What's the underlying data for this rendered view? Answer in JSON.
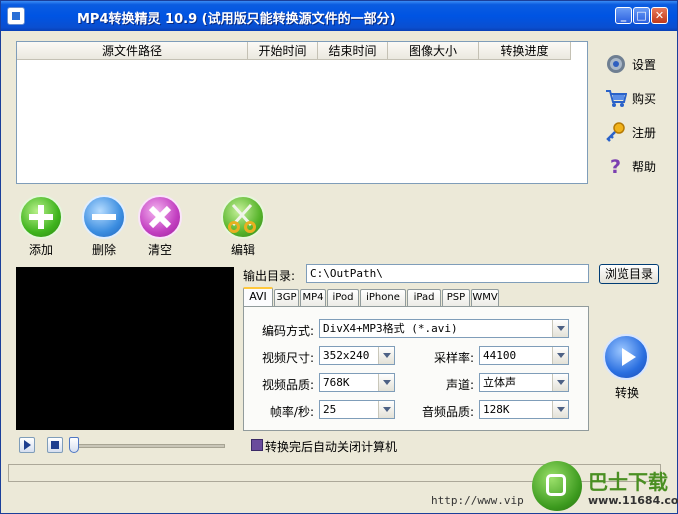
{
  "window": {
    "title": "MP4转换精灵 10.9 (试用版只能转换源文件的一部分)",
    "controls": {
      "minimize": "_",
      "maximize": "□",
      "close": "✕"
    }
  },
  "file_list": {
    "columns": [
      "源文件路径",
      "开始时间",
      "结束时间",
      "图像大小",
      "转换进度"
    ],
    "rows": []
  },
  "sidebar": {
    "items": [
      {
        "label": "设置",
        "icon": "gear-icon"
      },
      {
        "label": "购买",
        "icon": "cart-icon"
      },
      {
        "label": "注册",
        "icon": "key-icon"
      },
      {
        "label": "帮助",
        "icon": "help-icon"
      }
    ]
  },
  "toolbar": {
    "add_label": "添加",
    "delete_label": "删除",
    "clear_label": "清空",
    "edit_label": "编辑"
  },
  "output": {
    "label": "输出目录:",
    "path": "C:\\OutPath\\",
    "browse_label": "浏览目录"
  },
  "format_tabs": [
    "AVI",
    "3GP",
    "MP4",
    "iPod",
    "iPhone",
    "iPad",
    "PSP",
    "WMV"
  ],
  "active_tab": "AVI",
  "settings": {
    "codec": {
      "label": "编码方式:",
      "value": "DivX4+MP3格式 (*.avi)"
    },
    "video_size": {
      "label": "视频尺寸:",
      "value": "352x240"
    },
    "video_quality": {
      "label": "视频品质:",
      "value": "768K"
    },
    "frame_rate": {
      "label": "帧率/秒:",
      "value": "25"
    },
    "sample_rate": {
      "label": "采样率:",
      "value": "44100"
    },
    "channels": {
      "label": "声道:",
      "value": "立体声"
    },
    "audio_quality": {
      "label": "音频品质:",
      "value": "128K"
    }
  },
  "convert": {
    "label": "转换"
  },
  "shutdown": {
    "label": "转换完后自动关闭计算机",
    "checked": true
  },
  "footer": {
    "url": "http://www.vip"
  },
  "watermark": {
    "title": "巴士下载",
    "url": "www.11684.com"
  }
}
